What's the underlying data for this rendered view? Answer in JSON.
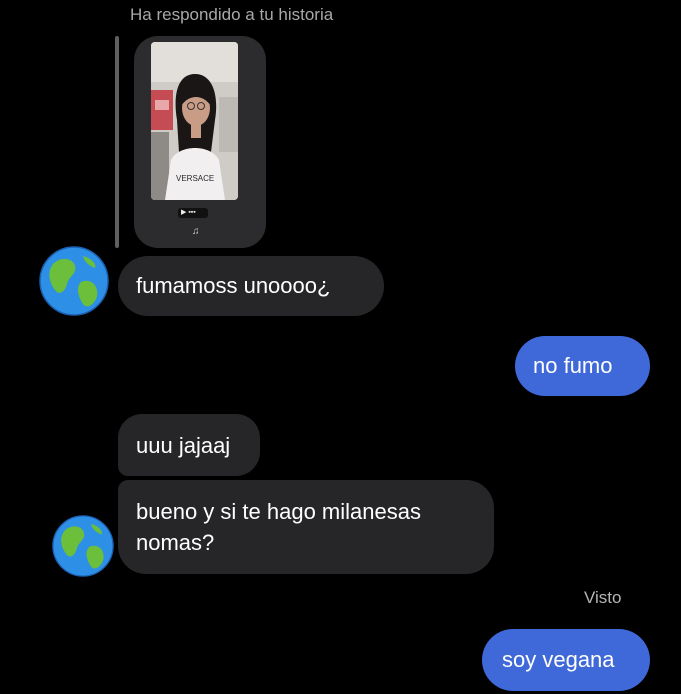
{
  "story_reply": {
    "caption": "Ha respondido a tu historia",
    "shirt_text": "VERSACE"
  },
  "messages": [
    {
      "side": "in",
      "text": "fumamoss unoooo¿"
    },
    {
      "side": "out",
      "text": "no fumo"
    },
    {
      "side": "in",
      "text": "uuu jajaaj"
    },
    {
      "side": "in",
      "text": "bueno y si te hago milanesas nomas?"
    },
    {
      "side": "out",
      "text": "soy vegana"
    }
  ],
  "status": {
    "seen_label": "Visto"
  },
  "avatar": {
    "icon": "globe-icon"
  },
  "colors": {
    "background": "#000000",
    "incoming_bubble": "#262628",
    "outgoing_bubble": "#3f68d9",
    "caption_text": "#a8a8a8"
  }
}
